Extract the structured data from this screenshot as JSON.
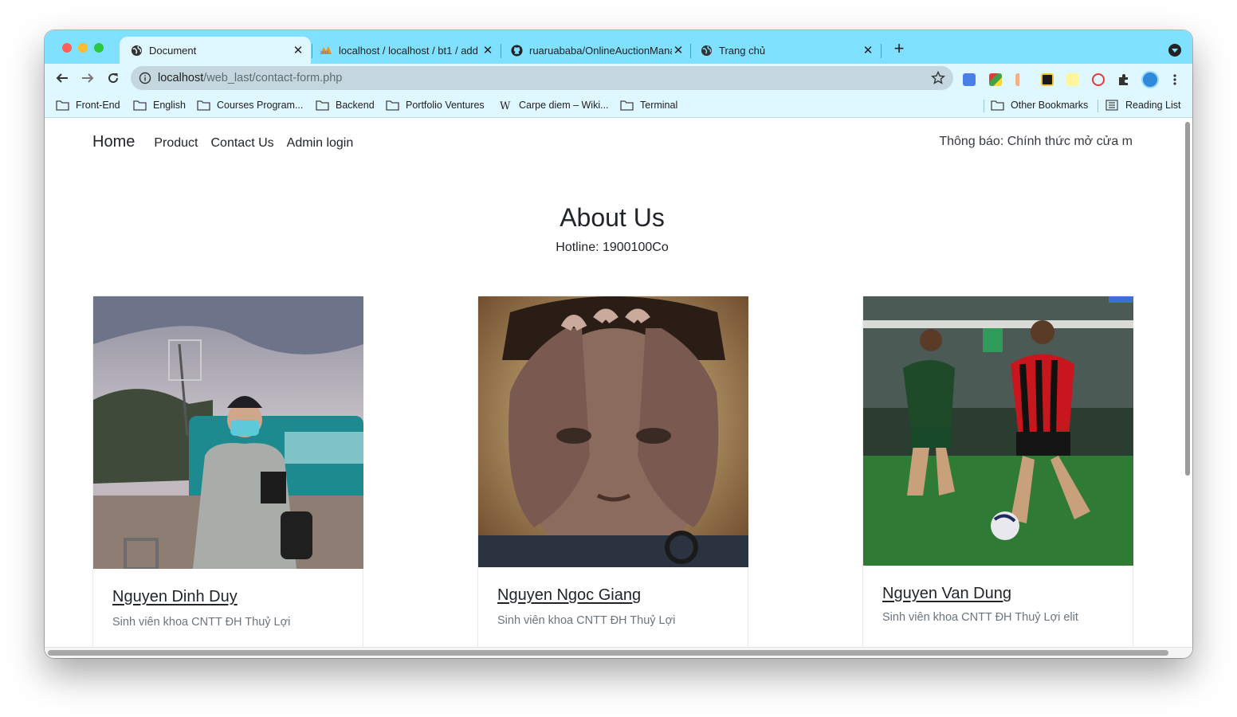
{
  "browser": {
    "tabs": [
      {
        "title": "Document",
        "favicon": "globe-icon",
        "active": true
      },
      {
        "title": "localhost / localhost / bt1 / add",
        "favicon": "phpmyadmin-icon",
        "active": false
      },
      {
        "title": "ruaruababa/OnlineAuctionMana",
        "favicon": "github-icon",
        "active": false
      },
      {
        "title": "Trang chủ",
        "favicon": "globe-icon",
        "active": false
      }
    ],
    "close_glyph": "✕",
    "new_tab_glyph": "+",
    "url_host": "localhost",
    "url_path": "/web_last/contact-form.php",
    "bookmarks": [
      {
        "label": "Front-End",
        "icon": "folder-icon"
      },
      {
        "label": "English",
        "icon": "folder-icon"
      },
      {
        "label": "Courses Program...",
        "icon": "folder-icon"
      },
      {
        "label": "Backend",
        "icon": "folder-icon"
      },
      {
        "label": "Portfolio Ventures",
        "icon": "folder-icon"
      },
      {
        "label": "Carpe diem – Wiki...",
        "icon": "wikipedia-icon"
      },
      {
        "label": "Terminal",
        "icon": "folder-icon"
      }
    ],
    "other_bookmarks": "Other Bookmarks",
    "reading_list": "Reading List"
  },
  "site": {
    "nav": {
      "brand": "Home",
      "links": [
        "Product",
        "Contact Us",
        "Admin login"
      ],
      "notice": "Thông báo: Chính thức mở cửa m"
    },
    "about": {
      "title": "About Us",
      "hotline": "Hotline: 1900100Co"
    },
    "members": [
      {
        "name": "Nguyen Dinh Duy",
        "description": "Sinh viên khoa CNTT ĐH Thuỷ Lợi"
      },
      {
        "name": "Nguyen Ngoc Giang",
        "description": "Sinh viên khoa CNTT ĐH Thuỷ Lợi"
      },
      {
        "name": "Nguyen Van Dung",
        "description": "Sinh viên khoa CNTT ĐH Thuỷ Lợi elit"
      }
    ]
  },
  "colors": {
    "tab_strip": "#80e0ff",
    "toolbar": "#dff7ff",
    "text": "#212529",
    "muted": "#6c757d"
  }
}
